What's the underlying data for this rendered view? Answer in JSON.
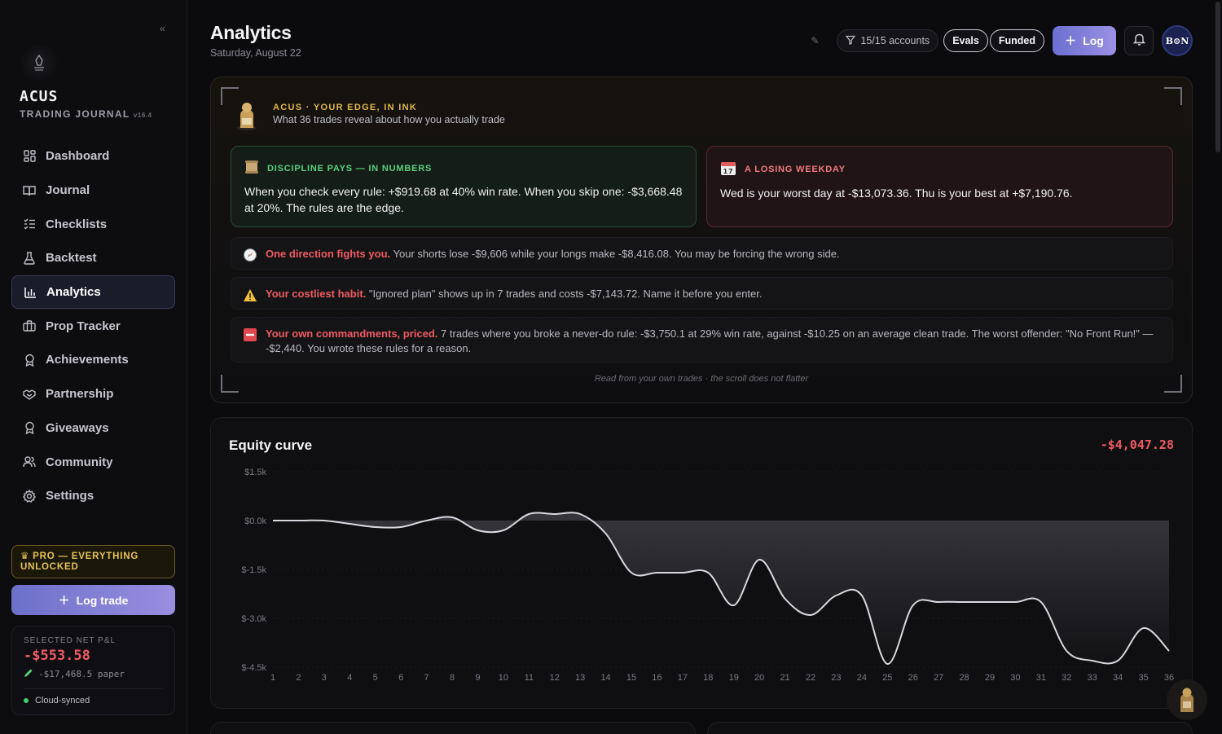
{
  "sidebar": {
    "brand": "ACUS",
    "brand_sub": "TRADING JOURNAL",
    "version": "v16.4",
    "collapse_glyph": "«",
    "items": [
      {
        "label": "Dashboard",
        "icon": "dashboard-icon"
      },
      {
        "label": "Journal",
        "icon": "book-icon"
      },
      {
        "label": "Checklists",
        "icon": "checklist-icon"
      },
      {
        "label": "Backtest",
        "icon": "flask-icon"
      },
      {
        "label": "Analytics",
        "icon": "bar-chart-icon",
        "active": true
      },
      {
        "label": "Prop Tracker",
        "icon": "briefcase-icon"
      },
      {
        "label": "Achievements",
        "icon": "award-icon"
      },
      {
        "label": "Partnership",
        "icon": "handshake-icon"
      },
      {
        "label": "Giveaways",
        "icon": "gift-icon"
      },
      {
        "label": "Community",
        "icon": "users-icon"
      },
      {
        "label": "Settings",
        "icon": "gear-icon"
      }
    ],
    "pro_label": "PRO — EVERYTHING UNLOCKED",
    "log_trade_label": "Log trade",
    "pnl": {
      "label": "SELECTED NET P&L",
      "value": "-$553.58",
      "paper": "-$17,468.5 paper",
      "sync": "Cloud-synced"
    }
  },
  "header": {
    "title": "Analytics",
    "date": "Saturday, August 22",
    "accounts": "15/15 accounts",
    "evals": "Evals",
    "funded": "Funded",
    "log_label": "Log",
    "avatar_text": "B⊙N"
  },
  "edge": {
    "kicker": "ACUS · YOUR EDGE, IN INK",
    "lead": "What 36 trades reveal about how you actually trade",
    "discipline": {
      "head": "DISCIPLINE PAYS — IN NUMBERS",
      "body": "When you check every rule: +$919.68 at 40% win rate. When you skip one: -$3,668.48 at 20%. The rules are the edge."
    },
    "weekday": {
      "head": "A LOSING WEEKDAY",
      "body": "Wed is your worst day at -$13,073.36. Thu is your best at +$7,190.76."
    },
    "insights": [
      {
        "icon": "compass-icon",
        "title": "One direction fights you.",
        "text": "Your shorts lose -$9,606 while your longs make -$8,416.08. You may be forcing the wrong side."
      },
      {
        "icon": "warning-icon",
        "title": "Your costliest habit.",
        "text": "\"Ignored plan\" shows up in 7 trades and costs -$7,143.72. Name it before you enter."
      },
      {
        "icon": "no-entry-icon",
        "title": "Your own commandments, priced.",
        "text": "7 trades where you broke a never-do rule: -$3,750.1 at 29% win rate, against -$10.25 on an average clean trade. The worst offender: \"No Front Run!\" — -$2,440. You wrote these rules for a reason."
      }
    ],
    "footer": "Read from your own trades · the scroll does not flatter"
  },
  "equity": {
    "title": "Equity curve",
    "total": "-$4,047.28"
  },
  "colors": {
    "accent": "#8d86dc",
    "negative": "#f05a63",
    "positive": "#5ad17d",
    "gold": "#e1b94a"
  },
  "chart_data": {
    "type": "area",
    "title": "Equity curve",
    "xlabel": "",
    "ylabel": "",
    "x": [
      1,
      2,
      3,
      4,
      5,
      6,
      7,
      8,
      9,
      10,
      11,
      12,
      13,
      14,
      15,
      16,
      17,
      18,
      19,
      20,
      21,
      22,
      23,
      24,
      25,
      26,
      27,
      28,
      29,
      30,
      31,
      32,
      33,
      34,
      35,
      36
    ],
    "y": [
      0,
      0,
      0,
      -100,
      -200,
      -200,
      0,
      100,
      -300,
      -300,
      200,
      200,
      200,
      -400,
      -1600,
      -1600,
      -1600,
      -1600,
      -2600,
      -1200,
      -2400,
      -2900,
      -2300,
      -2300,
      -4400,
      -2600,
      -2500,
      -2500,
      -2500,
      -2500,
      -2500,
      -4000,
      -4300,
      -4300,
      -3300,
      -4000
    ],
    "yticks": [
      "$1.5k",
      "$0.0k",
      "$-1.5k",
      "$-3.0k",
      "$-4.5k"
    ],
    "ylim": [
      -4500,
      1500
    ],
    "grid": true
  }
}
